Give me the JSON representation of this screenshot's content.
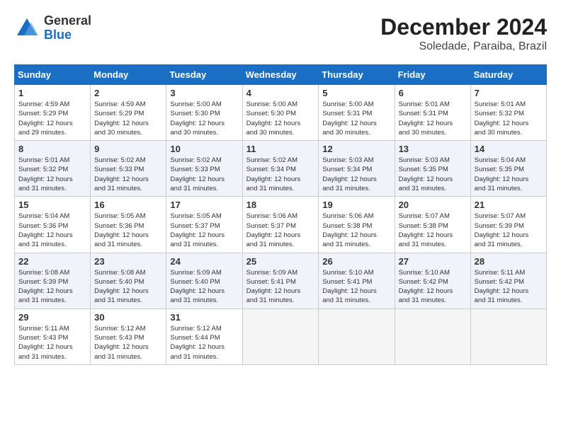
{
  "header": {
    "logo_general": "General",
    "logo_blue": "Blue",
    "month_title": "December 2024",
    "location": "Soledade, Paraiba, Brazil"
  },
  "days_of_week": [
    "Sunday",
    "Monday",
    "Tuesday",
    "Wednesday",
    "Thursday",
    "Friday",
    "Saturday"
  ],
  "weeks": [
    [
      {
        "day": "1",
        "info": "Sunrise: 4:59 AM\nSunset: 5:29 PM\nDaylight: 12 hours\nand 29 minutes."
      },
      {
        "day": "2",
        "info": "Sunrise: 4:59 AM\nSunset: 5:29 PM\nDaylight: 12 hours\nand 30 minutes."
      },
      {
        "day": "3",
        "info": "Sunrise: 5:00 AM\nSunset: 5:30 PM\nDaylight: 12 hours\nand 30 minutes."
      },
      {
        "day": "4",
        "info": "Sunrise: 5:00 AM\nSunset: 5:30 PM\nDaylight: 12 hours\nand 30 minutes."
      },
      {
        "day": "5",
        "info": "Sunrise: 5:00 AM\nSunset: 5:31 PM\nDaylight: 12 hours\nand 30 minutes."
      },
      {
        "day": "6",
        "info": "Sunrise: 5:01 AM\nSunset: 5:31 PM\nDaylight: 12 hours\nand 30 minutes."
      },
      {
        "day": "7",
        "info": "Sunrise: 5:01 AM\nSunset: 5:32 PM\nDaylight: 12 hours\nand 30 minutes."
      }
    ],
    [
      {
        "day": "8",
        "info": "Sunrise: 5:01 AM\nSunset: 5:32 PM\nDaylight: 12 hours\nand 31 minutes."
      },
      {
        "day": "9",
        "info": "Sunrise: 5:02 AM\nSunset: 5:33 PM\nDaylight: 12 hours\nand 31 minutes."
      },
      {
        "day": "10",
        "info": "Sunrise: 5:02 AM\nSunset: 5:33 PM\nDaylight: 12 hours\nand 31 minutes."
      },
      {
        "day": "11",
        "info": "Sunrise: 5:02 AM\nSunset: 5:34 PM\nDaylight: 12 hours\nand 31 minutes."
      },
      {
        "day": "12",
        "info": "Sunrise: 5:03 AM\nSunset: 5:34 PM\nDaylight: 12 hours\nand 31 minutes."
      },
      {
        "day": "13",
        "info": "Sunrise: 5:03 AM\nSunset: 5:35 PM\nDaylight: 12 hours\nand 31 minutes."
      },
      {
        "day": "14",
        "info": "Sunrise: 5:04 AM\nSunset: 5:35 PM\nDaylight: 12 hours\nand 31 minutes."
      }
    ],
    [
      {
        "day": "15",
        "info": "Sunrise: 5:04 AM\nSunset: 5:36 PM\nDaylight: 12 hours\nand 31 minutes."
      },
      {
        "day": "16",
        "info": "Sunrise: 5:05 AM\nSunset: 5:36 PM\nDaylight: 12 hours\nand 31 minutes."
      },
      {
        "day": "17",
        "info": "Sunrise: 5:05 AM\nSunset: 5:37 PM\nDaylight: 12 hours\nand 31 minutes."
      },
      {
        "day": "18",
        "info": "Sunrise: 5:06 AM\nSunset: 5:37 PM\nDaylight: 12 hours\nand 31 minutes."
      },
      {
        "day": "19",
        "info": "Sunrise: 5:06 AM\nSunset: 5:38 PM\nDaylight: 12 hours\nand 31 minutes."
      },
      {
        "day": "20",
        "info": "Sunrise: 5:07 AM\nSunset: 5:38 PM\nDaylight: 12 hours\nand 31 minutes."
      },
      {
        "day": "21",
        "info": "Sunrise: 5:07 AM\nSunset: 5:39 PM\nDaylight: 12 hours\nand 31 minutes."
      }
    ],
    [
      {
        "day": "22",
        "info": "Sunrise: 5:08 AM\nSunset: 5:39 PM\nDaylight: 12 hours\nand 31 minutes."
      },
      {
        "day": "23",
        "info": "Sunrise: 5:08 AM\nSunset: 5:40 PM\nDaylight: 12 hours\nand 31 minutes."
      },
      {
        "day": "24",
        "info": "Sunrise: 5:09 AM\nSunset: 5:40 PM\nDaylight: 12 hours\nand 31 minutes."
      },
      {
        "day": "25",
        "info": "Sunrise: 5:09 AM\nSunset: 5:41 PM\nDaylight: 12 hours\nand 31 minutes."
      },
      {
        "day": "26",
        "info": "Sunrise: 5:10 AM\nSunset: 5:41 PM\nDaylight: 12 hours\nand 31 minutes."
      },
      {
        "day": "27",
        "info": "Sunrise: 5:10 AM\nSunset: 5:42 PM\nDaylight: 12 hours\nand 31 minutes."
      },
      {
        "day": "28",
        "info": "Sunrise: 5:11 AM\nSunset: 5:42 PM\nDaylight: 12 hours\nand 31 minutes."
      }
    ],
    [
      {
        "day": "29",
        "info": "Sunrise: 5:11 AM\nSunset: 5:43 PM\nDaylight: 12 hours\nand 31 minutes."
      },
      {
        "day": "30",
        "info": "Sunrise: 5:12 AM\nSunset: 5:43 PM\nDaylight: 12 hours\nand 31 minutes."
      },
      {
        "day": "31",
        "info": "Sunrise: 5:12 AM\nSunset: 5:44 PM\nDaylight: 12 hours\nand 31 minutes."
      },
      null,
      null,
      null,
      null
    ]
  ]
}
